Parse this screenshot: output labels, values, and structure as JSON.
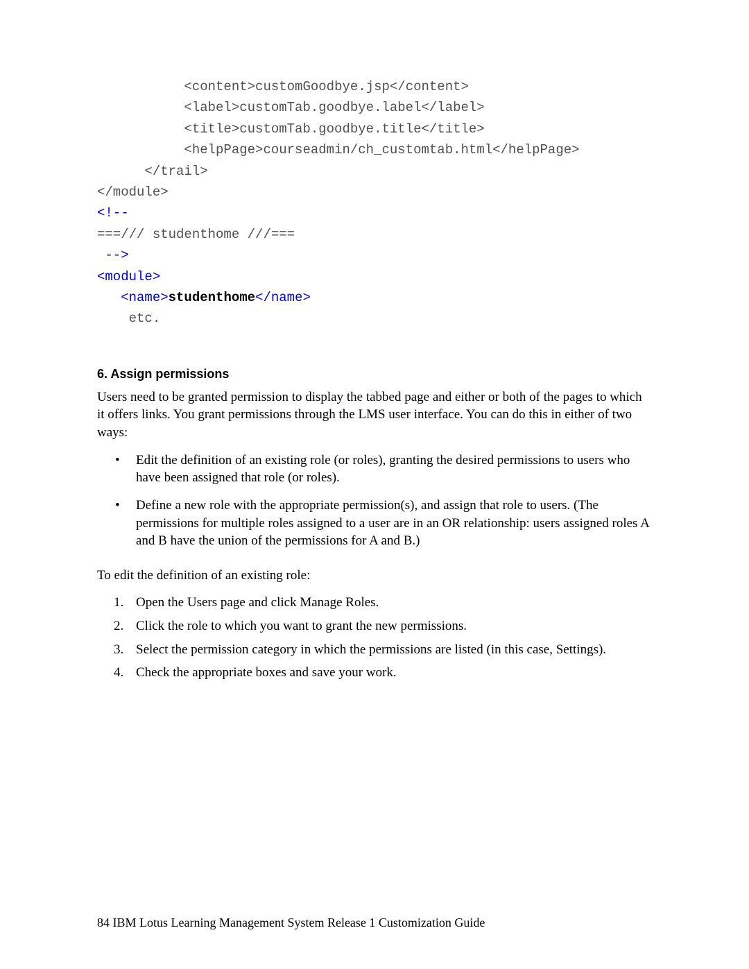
{
  "code": {
    "l1": {
      "pre": "           <content>",
      "text": "customGoodbye.jsp",
      "post": "</content>"
    },
    "l2": {
      "pre": "           <label>",
      "text": "customTab.goodbye.label",
      "post": "</label>"
    },
    "l3": {
      "pre": "           <title>",
      "text": "customTab.goodbye.title",
      "post": "</title>"
    },
    "l4": {
      "pre": "           <helpPage>",
      "text": "courseadmin/ch_customtab.html",
      "post": "</helpPage>"
    },
    "l5": "      </trail>",
    "l6": "</module>",
    "l7": "<!--",
    "l8": "===/// studenthome ///===",
    "l9": " -->",
    "l10": "<module>",
    "l11": {
      "pre": "   <name>",
      "text": "studenthome",
      "post": "</name>"
    },
    "l12": "    etc."
  },
  "section": {
    "heading": "6. Assign permissions",
    "intro": "Users need to be granted permission to display the tabbed page and either or both of the pages to which it offers links. You grant permissions through the LMS user interface. You can do this in either of two ways:",
    "bullets": [
      "Edit the definition of an existing role (or roles), granting the desired permissions to users who have been assigned that role (or roles).",
      "Define a new role with the appropriate permission(s), and assign that role to users. (The permissions for multiple roles assigned to a user are in an OR relationship: users assigned roles A and B have the union of the permissions for A and B.)"
    ],
    "edit_intro": "To edit the definition of an existing role:",
    "steps": [
      "Open the Users page and click Manage Roles.",
      "Click the role to which you want to grant the new permissions.",
      "Select the permission category in which the permissions are listed (in this case, Settings).",
      "Check the appropriate boxes and save your work."
    ]
  },
  "footer": {
    "page_number": "84",
    "title": " IBM Lotus Learning Management System Release 1 Customization Guide"
  }
}
